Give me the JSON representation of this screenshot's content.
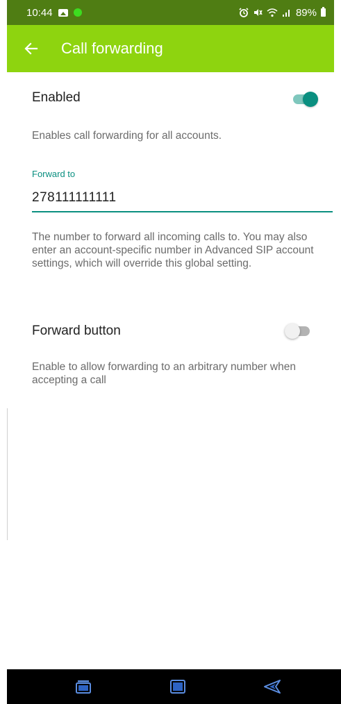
{
  "status_bar": {
    "time": "10:44",
    "battery": "89%",
    "icons": [
      "image-icon",
      "notification-dot-icon",
      "alarm-icon",
      "mute-icon",
      "wifi-icon",
      "signal-icon",
      "battery-icon"
    ]
  },
  "app_bar": {
    "title": "Call forwarding",
    "back_icon": "back-arrow-icon",
    "color": "#8ed40f"
  },
  "settings": {
    "enabled": {
      "title": "Enabled",
      "summary": "Enables call forwarding for all accounts.",
      "on": true
    },
    "forward_to": {
      "label": "Forward to",
      "value": "278111111111",
      "summary": "The number to forward all incoming calls to. You may also enter an account-specific number in Advanced SIP account settings, which will override this global setting."
    },
    "forward_button": {
      "title": "Forward button",
      "summary": "Enable to allow forwarding to an arbitrary number when accepting a call",
      "on": false
    }
  },
  "nav_bar": {
    "buttons": [
      "recents-icon",
      "home-icon",
      "back-icon"
    ]
  },
  "colors": {
    "accent": "#0a8f80",
    "app_bar": "#8ed40f",
    "status_bar": "#4f7d13"
  }
}
